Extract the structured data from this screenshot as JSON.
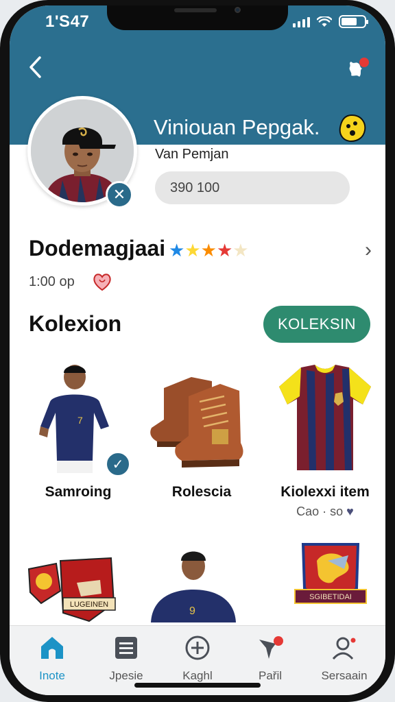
{
  "status_bar": {
    "time": "1'S47",
    "battery_level": 0.7
  },
  "header": {
    "back_icon": "chevron-left-icon",
    "notification_icon": "notification-icon"
  },
  "profile": {
    "name": "Viniouan Pepgak.",
    "subtitle": "Van Pemjan",
    "field_value": "390 100",
    "name_emoji": "yellow-face-icon"
  },
  "ranking": {
    "title": "Dodemagjaai",
    "stars_shown": 5,
    "time": "1:00 op"
  },
  "collection": {
    "title": "Kolexion",
    "button_label": "KOLEKSIN",
    "items": [
      {
        "label": "Samroing",
        "sub": ""
      },
      {
        "label": "Rolescia",
        "sub": ""
      },
      {
        "label": "Kiolexxi item",
        "sub": "Cao · so"
      }
    ],
    "row2": [
      {
        "badge_text": "LUGEINEN"
      },
      {
        "badge_text": ""
      },
      {
        "badge_text": "SGIBETIDAI"
      }
    ]
  },
  "nav": [
    {
      "label": "Inote",
      "icon": "home-icon",
      "active": true
    },
    {
      "label": "Jpesie",
      "icon": "list-icon",
      "active": false
    },
    {
      "label": "Kaghl",
      "icon": "plus-circle-icon",
      "active": false
    },
    {
      "label": "Pařil",
      "icon": "flag-icon",
      "active": false
    },
    {
      "label": "Sersaain",
      "icon": "profile-icon",
      "active": false
    }
  ],
  "colors": {
    "header": "#2b6f8f",
    "accent_button": "#2e8b6f",
    "active_nav": "#1c93c6"
  }
}
